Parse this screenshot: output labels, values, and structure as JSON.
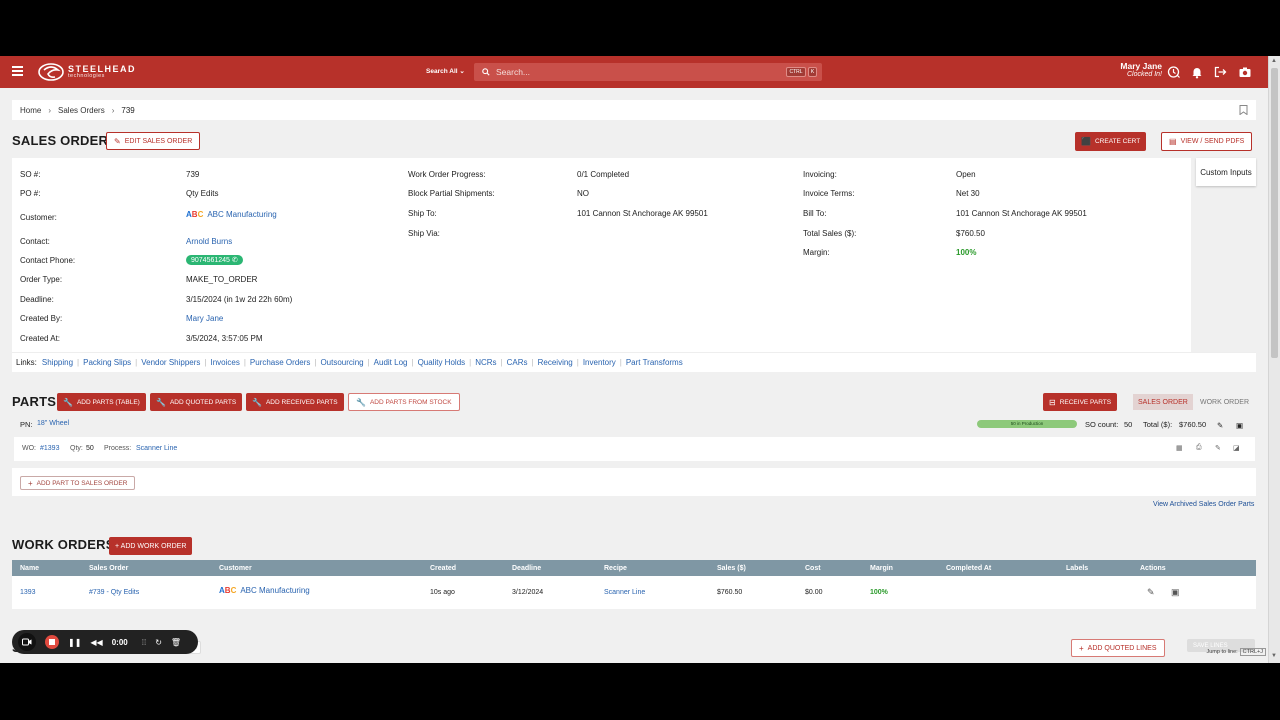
{
  "topbar": {
    "logo_main": "STEELHEAD",
    "logo_sub": "technologies",
    "search_scope": "Search All",
    "search_placeholder": "Search...",
    "kbd_ctrl": "CTRL",
    "kbd_k": "K",
    "user_name": "Mary Jane",
    "user_status": "Clocked In!"
  },
  "breadcrumb": {
    "home": "Home",
    "sales_orders": "Sales Orders",
    "current": "739"
  },
  "sales_order": {
    "heading": "SALES ORDER",
    "edit_label": "EDIT SALES ORDER",
    "create_cert_label": "CREATE CERT",
    "view_pdfs_label": "VIEW / SEND PDFS",
    "custom_inputs_label": "Custom Inputs",
    "col1": [
      {
        "k": "SO #:",
        "v": "739"
      },
      {
        "k": "PO #:",
        "v": "Qty Edits"
      },
      {
        "k": "Customer:",
        "v": "ABC Manufacturing"
      },
      {
        "k": "Contact:",
        "v": "Arnold Burns"
      },
      {
        "k": "Contact Phone:",
        "v": "9074561245"
      },
      {
        "k": "Order Type:",
        "v": "MAKE_TO_ORDER"
      },
      {
        "k": "Deadline:",
        "v": "3/15/2024 (in 1w 2d 22h 60m)"
      },
      {
        "k": "Created By:",
        "v": "Mary Jane"
      },
      {
        "k": "Created At:",
        "v": "3/5/2024, 3:57:05 PM"
      }
    ],
    "col2": [
      {
        "k": "Work Order Progress:",
        "v": "0/1 Completed"
      },
      {
        "k": "Block Partial Shipments:",
        "v": "NO"
      },
      {
        "k": "Ship To:",
        "v": "101 Cannon St Anchorage AK 99501"
      },
      {
        "k": "Ship Via:",
        "v": ""
      }
    ],
    "col3": [
      {
        "k": "Invoicing:",
        "v": "Open"
      },
      {
        "k": "Invoice Terms:",
        "v": "Net 30"
      },
      {
        "k": "Bill To:",
        "v": "101 Cannon St Anchorage AK 99501"
      },
      {
        "k": "Total Sales ($):",
        "v": "$760.50"
      },
      {
        "k": "Margin:",
        "v": "100%"
      }
    ],
    "links_label": "Links:",
    "links": [
      "Shipping",
      "Packing Slips",
      "Vendor Shippers",
      "Invoices",
      "Purchase Orders",
      "Outsourcing",
      "Audit Log",
      "Quality Holds",
      "NCRs",
      "CARs",
      "Receiving",
      "Inventory",
      "Part Transforms"
    ]
  },
  "parts": {
    "heading": "PARTS",
    "add_table": "ADD PARTS (TABLE)",
    "add_quoted": "ADD QUOTED PARTS",
    "add_received": "ADD RECEIVED PARTS",
    "add_from_stock": "ADD PARTS FROM STOCK",
    "receive_parts": "RECEIVE PARTS",
    "tab_sales_order": "SALES ORDER",
    "tab_work_order": "WORK ORDER",
    "pn_label": "PN:",
    "pn_value": "18\" Wheel",
    "progress_text": "50 in Production",
    "progress_fraction": 1.0,
    "so_count_label": "SO count:",
    "so_count_value": "50",
    "total_label": "Total ($):",
    "total_value": "$760.50",
    "wo_label": "WO:",
    "wo_value": "#1393",
    "qty_label": "Qty:",
    "qty_value": "50",
    "process_label": "Process:",
    "process_value": "Scanner Line",
    "add_part_to_so": "ADD PART TO SALES ORDER",
    "view_archived": "View Archived Sales Order Parts"
  },
  "work_orders": {
    "heading": "WORK ORDERS",
    "add_label": "+ ADD WORK ORDER",
    "columns": [
      "Name",
      "Sales Order",
      "Customer",
      "Created",
      "Deadline",
      "Recipe",
      "Sales ($)",
      "Cost",
      "Margin",
      "Completed At",
      "Labels",
      "Actions"
    ],
    "rows": [
      {
        "name": "1393",
        "sales_order": "#739 - Qty Edits",
        "customer": "ABC Manufacturing",
        "created": "10s ago",
        "deadline": "3/12/2024",
        "recipe": "Scanner Line",
        "sales": "$760.50",
        "cost": "$0.00",
        "margin": "100%",
        "completed_at": "",
        "labels": ""
      }
    ]
  },
  "bottom": {
    "heading_partial": "S",
    "lines_partial": "ES",
    "add_quoted_lines": "ADD QUOTED LINES",
    "save_partial": "SAVE LINES",
    "jump_label": "Jump to line:",
    "jump_key": "CTRL+J"
  },
  "recorder": {
    "time": "0:00"
  },
  "colors": {
    "brand": "#b7312a",
    "link": "#2a64b0",
    "table_header": "#7f97a4",
    "success": "#2bb673"
  }
}
